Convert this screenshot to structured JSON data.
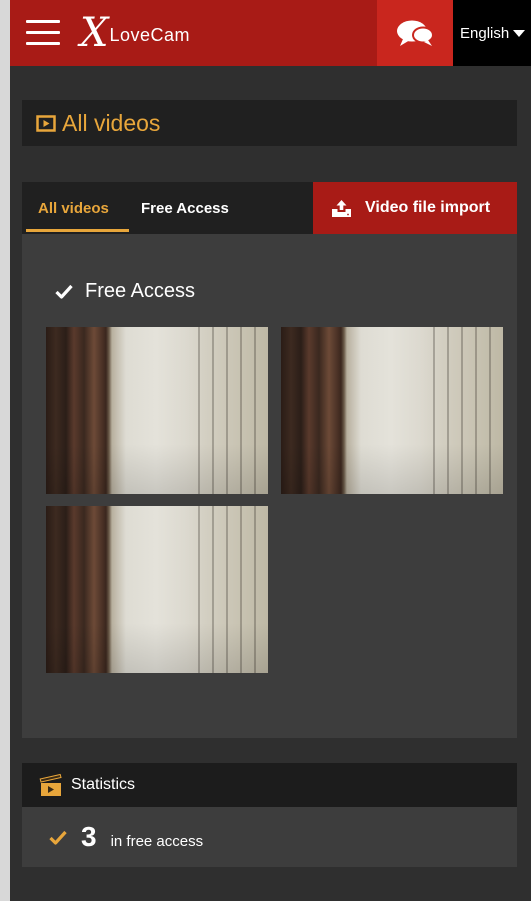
{
  "header": {
    "logo_initial": "X",
    "logo_rest": "LoveCam",
    "language": "English"
  },
  "page_title": "All videos",
  "tabs": [
    {
      "label": "All videos",
      "active": true
    },
    {
      "label": "Free Access",
      "active": false
    }
  ],
  "import_button": "Video file import",
  "section": {
    "title": "Free Access",
    "thumbnails": 3
  },
  "statistics": {
    "title": "Statistics",
    "count": "3",
    "label": "in free access"
  },
  "colors": {
    "brand_red": "#a81b16",
    "accent_orange": "#e8a63b",
    "panel_dark": "#202020",
    "panel_mid": "#3d3d3d"
  }
}
